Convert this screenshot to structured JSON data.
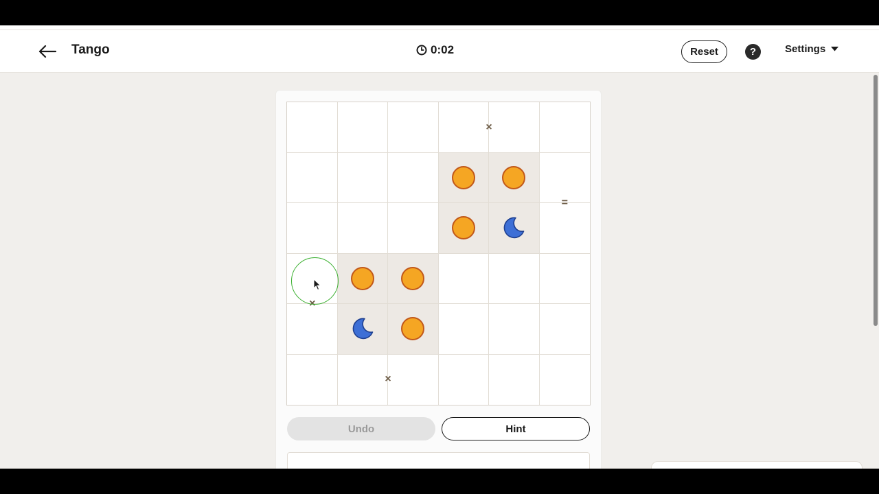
{
  "header": {
    "title": "Tango",
    "timer": "0:02",
    "reset_label": "Reset",
    "help_label": "?",
    "settings_label": "Settings"
  },
  "board": {
    "size": 6,
    "cells": [
      [
        "",
        "",
        "",
        "",
        "",
        ""
      ],
      [
        "",
        "",
        "",
        "sun",
        "sun",
        ""
      ],
      [
        "",
        "",
        "",
        "sun",
        "moon",
        ""
      ],
      [
        "",
        "sun",
        "sun",
        "",
        "",
        ""
      ],
      [
        "",
        "moon",
        "sun",
        "",
        "",
        ""
      ],
      [
        "",
        "",
        "",
        "",
        "",
        ""
      ]
    ],
    "locked": [
      [
        1,
        3
      ],
      [
        1,
        4
      ],
      [
        2,
        3
      ],
      [
        2,
        4
      ],
      [
        3,
        1
      ],
      [
        3,
        2
      ],
      [
        4,
        1
      ],
      [
        4,
        2
      ]
    ],
    "constraints": [
      {
        "type": "×",
        "between": [
          [
            0,
            3
          ],
          [
            0,
            4
          ]
        ]
      },
      {
        "type": "=",
        "between": [
          [
            1,
            5
          ],
          [
            2,
            5
          ]
        ]
      },
      {
        "type": "×",
        "between": [
          [
            3,
            0
          ],
          [
            4,
            0
          ]
        ]
      },
      {
        "type": "×",
        "between": [
          [
            5,
            1
          ],
          [
            5,
            2
          ]
        ]
      }
    ],
    "highlight_cell": [
      3,
      0
    ]
  },
  "actions": {
    "undo_label": "Undo",
    "hint_label": "Hint"
  },
  "colors": {
    "sun_fill": "#f5a623",
    "sun_stroke": "#c1581a",
    "moon_fill": "#3d6fd6",
    "moon_stroke": "#1e3f8f",
    "highlight": "#3bb030",
    "locked_cell": "#ede9e4"
  }
}
